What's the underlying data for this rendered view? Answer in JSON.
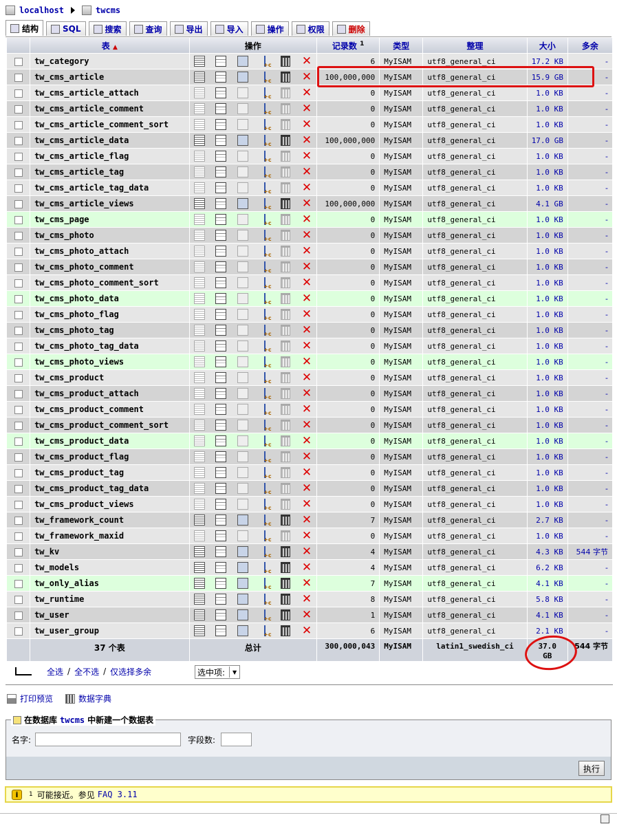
{
  "breadcrumb": {
    "server": "localhost",
    "database": "twcms"
  },
  "tabs": [
    {
      "label": "结构",
      "icon": "structure-icon",
      "active": true
    },
    {
      "label": "SQL",
      "icon": "sql-icon"
    },
    {
      "label": "搜索",
      "icon": "search-icon"
    },
    {
      "label": "查询",
      "icon": "query-icon"
    },
    {
      "label": "导出",
      "icon": "export-icon"
    },
    {
      "label": "导入",
      "icon": "import-icon"
    },
    {
      "label": "操作",
      "icon": "operations-icon"
    },
    {
      "label": "权限",
      "icon": "privileges-icon"
    },
    {
      "label": "删除",
      "icon": "drop-icon",
      "danger": true
    }
  ],
  "columns": {
    "table": "表",
    "action": "操作",
    "records": "记录数",
    "records_sup": "1",
    "type": "类型",
    "collation": "整理",
    "size": "大小",
    "overhead": "多余"
  },
  "rows": [
    {
      "name": "tw_category",
      "records": "6",
      "type": "MyISAM",
      "collation": "utf8_general_ci",
      "size": "17.2 KB",
      "overhead": "-",
      "has_data": true,
      "hl": false
    },
    {
      "name": "tw_cms_article",
      "records": "100,000,000",
      "type": "MyISAM",
      "collation": "utf8_general_ci",
      "size": "15.9 GB",
      "overhead": "-",
      "has_data": true,
      "hl": false
    },
    {
      "name": "tw_cms_article_attach",
      "records": "0",
      "type": "MyISAM",
      "collation": "utf8_general_ci",
      "size": "1.0 KB",
      "overhead": "-",
      "has_data": false,
      "hl": false
    },
    {
      "name": "tw_cms_article_comment",
      "records": "0",
      "type": "MyISAM",
      "collation": "utf8_general_ci",
      "size": "1.0 KB",
      "overhead": "-",
      "has_data": false,
      "hl": false
    },
    {
      "name": "tw_cms_article_comment_sort",
      "records": "0",
      "type": "MyISAM",
      "collation": "utf8_general_ci",
      "size": "1.0 KB",
      "overhead": "-",
      "has_data": false,
      "hl": false
    },
    {
      "name": "tw_cms_article_data",
      "records": "100,000,000",
      "type": "MyISAM",
      "collation": "utf8_general_ci",
      "size": "17.0 GB",
      "overhead": "-",
      "has_data": true,
      "hl": false
    },
    {
      "name": "tw_cms_article_flag",
      "records": "0",
      "type": "MyISAM",
      "collation": "utf8_general_ci",
      "size": "1.0 KB",
      "overhead": "-",
      "has_data": false,
      "hl": false
    },
    {
      "name": "tw_cms_article_tag",
      "records": "0",
      "type": "MyISAM",
      "collation": "utf8_general_ci",
      "size": "1.0 KB",
      "overhead": "-",
      "has_data": false,
      "hl": false
    },
    {
      "name": "tw_cms_article_tag_data",
      "records": "0",
      "type": "MyISAM",
      "collation": "utf8_general_ci",
      "size": "1.0 KB",
      "overhead": "-",
      "has_data": false,
      "hl": false
    },
    {
      "name": "tw_cms_article_views",
      "records": "100,000,000",
      "type": "MyISAM",
      "collation": "utf8_general_ci",
      "size": "4.1 GB",
      "overhead": "-",
      "has_data": true,
      "hl": false
    },
    {
      "name": "tw_cms_page",
      "records": "0",
      "type": "MyISAM",
      "collation": "utf8_general_ci",
      "size": "1.0 KB",
      "overhead": "-",
      "has_data": false,
      "hl": true
    },
    {
      "name": "tw_cms_photo",
      "records": "0",
      "type": "MyISAM",
      "collation": "utf8_general_ci",
      "size": "1.0 KB",
      "overhead": "-",
      "has_data": false,
      "hl": false
    },
    {
      "name": "tw_cms_photo_attach",
      "records": "0",
      "type": "MyISAM",
      "collation": "utf8_general_ci",
      "size": "1.0 KB",
      "overhead": "-",
      "has_data": false,
      "hl": false
    },
    {
      "name": "tw_cms_photo_comment",
      "records": "0",
      "type": "MyISAM",
      "collation": "utf8_general_ci",
      "size": "1.0 KB",
      "overhead": "-",
      "has_data": false,
      "hl": false
    },
    {
      "name": "tw_cms_photo_comment_sort",
      "records": "0",
      "type": "MyISAM",
      "collation": "utf8_general_ci",
      "size": "1.0 KB",
      "overhead": "-",
      "has_data": false,
      "hl": false
    },
    {
      "name": "tw_cms_photo_data",
      "records": "0",
      "type": "MyISAM",
      "collation": "utf8_general_ci",
      "size": "1.0 KB",
      "overhead": "-",
      "has_data": false,
      "hl": true
    },
    {
      "name": "tw_cms_photo_flag",
      "records": "0",
      "type": "MyISAM",
      "collation": "utf8_general_ci",
      "size": "1.0 KB",
      "overhead": "-",
      "has_data": false,
      "hl": false
    },
    {
      "name": "tw_cms_photo_tag",
      "records": "0",
      "type": "MyISAM",
      "collation": "utf8_general_ci",
      "size": "1.0 KB",
      "overhead": "-",
      "has_data": false,
      "hl": false
    },
    {
      "name": "tw_cms_photo_tag_data",
      "records": "0",
      "type": "MyISAM",
      "collation": "utf8_general_ci",
      "size": "1.0 KB",
      "overhead": "-",
      "has_data": false,
      "hl": false
    },
    {
      "name": "tw_cms_photo_views",
      "records": "0",
      "type": "MyISAM",
      "collation": "utf8_general_ci",
      "size": "1.0 KB",
      "overhead": "-",
      "has_data": false,
      "hl": true
    },
    {
      "name": "tw_cms_product",
      "records": "0",
      "type": "MyISAM",
      "collation": "utf8_general_ci",
      "size": "1.0 KB",
      "overhead": "-",
      "has_data": false,
      "hl": false
    },
    {
      "name": "tw_cms_product_attach",
      "records": "0",
      "type": "MyISAM",
      "collation": "utf8_general_ci",
      "size": "1.0 KB",
      "overhead": "-",
      "has_data": false,
      "hl": false
    },
    {
      "name": "tw_cms_product_comment",
      "records": "0",
      "type": "MyISAM",
      "collation": "utf8_general_ci",
      "size": "1.0 KB",
      "overhead": "-",
      "has_data": false,
      "hl": false
    },
    {
      "name": "tw_cms_product_comment_sort",
      "records": "0",
      "type": "MyISAM",
      "collation": "utf8_general_ci",
      "size": "1.0 KB",
      "overhead": "-",
      "has_data": false,
      "hl": false
    },
    {
      "name": "tw_cms_product_data",
      "records": "0",
      "type": "MyISAM",
      "collation": "utf8_general_ci",
      "size": "1.0 KB",
      "overhead": "-",
      "has_data": false,
      "hl": true
    },
    {
      "name": "tw_cms_product_flag",
      "records": "0",
      "type": "MyISAM",
      "collation": "utf8_general_ci",
      "size": "1.0 KB",
      "overhead": "-",
      "has_data": false,
      "hl": false
    },
    {
      "name": "tw_cms_product_tag",
      "records": "0",
      "type": "MyISAM",
      "collation": "utf8_general_ci",
      "size": "1.0 KB",
      "overhead": "-",
      "has_data": false,
      "hl": false
    },
    {
      "name": "tw_cms_product_tag_data",
      "records": "0",
      "type": "MyISAM",
      "collation": "utf8_general_ci",
      "size": "1.0 KB",
      "overhead": "-",
      "has_data": false,
      "hl": false
    },
    {
      "name": "tw_cms_product_views",
      "records": "0",
      "type": "MyISAM",
      "collation": "utf8_general_ci",
      "size": "1.0 KB",
      "overhead": "-",
      "has_data": false,
      "hl": false
    },
    {
      "name": "tw_framework_count",
      "records": "7",
      "type": "MyISAM",
      "collation": "utf8_general_ci",
      "size": "2.7 KB",
      "overhead": "-",
      "has_data": true,
      "hl": false
    },
    {
      "name": "tw_framework_maxid",
      "records": "0",
      "type": "MyISAM",
      "collation": "utf8_general_ci",
      "size": "1.0 KB",
      "overhead": "-",
      "has_data": false,
      "hl": false
    },
    {
      "name": "tw_kv",
      "records": "4",
      "type": "MyISAM",
      "collation": "utf8_general_ci",
      "size": "4.3 KB",
      "overhead": "544 字节",
      "has_data": true,
      "hl": false
    },
    {
      "name": "tw_models",
      "records": "4",
      "type": "MyISAM",
      "collation": "utf8_general_ci",
      "size": "6.2 KB",
      "overhead": "-",
      "has_data": true,
      "hl": false
    },
    {
      "name": "tw_only_alias",
      "records": "7",
      "type": "MyISAM",
      "collation": "utf8_general_ci",
      "size": "4.1 KB",
      "overhead": "-",
      "has_data": true,
      "hl": true
    },
    {
      "name": "tw_runtime",
      "records": "8",
      "type": "MyISAM",
      "collation": "utf8_general_ci",
      "size": "5.8 KB",
      "overhead": "-",
      "has_data": true,
      "hl": false
    },
    {
      "name": "tw_user",
      "records": "1",
      "type": "MyISAM",
      "collation": "utf8_general_ci",
      "size": "4.1 KB",
      "overhead": "-",
      "has_data": true,
      "hl": false
    },
    {
      "name": "tw_user_group",
      "records": "6",
      "type": "MyISAM",
      "collation": "utf8_general_ci",
      "size": "2.1 KB",
      "overhead": "-",
      "has_data": true,
      "hl": false
    }
  ],
  "footer": {
    "count_label": "37 个表",
    "total_label": "总计",
    "records": "300,000,043",
    "type": "MyISAM",
    "collation": "latin1_swedish_ci",
    "size": "37.0 GB",
    "overhead": "544 字节"
  },
  "selection": {
    "check_all": "全选",
    "uncheck_all": "全不选",
    "check_overhead": "仅选择多余",
    "separator": "/",
    "with_selected": "选中项:"
  },
  "links": {
    "print_view": "打印预览",
    "data_dictionary": "数据字典"
  },
  "create_table": {
    "legend_prefix": "在数据库",
    "legend_db": "twcms",
    "legend_suffix": "中新建一个数据表",
    "name_label": "名字:",
    "fields_label": "字段数:",
    "name_value": "",
    "fields_value": "",
    "go_button": "执行"
  },
  "note": {
    "sup": "1",
    "text": "可能接近。参见",
    "link": "FAQ 3.11"
  },
  "colors": {
    "link": "#0000aa",
    "highlight_row": "#ddffdd",
    "annotation": "#dd1111"
  }
}
